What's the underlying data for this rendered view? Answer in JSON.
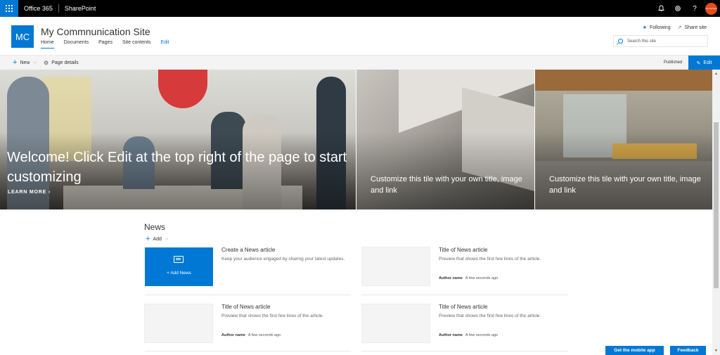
{
  "suitebar": {
    "brand": "Office 365",
    "app": "SharePoint",
    "avatar_text": "Anonymous"
  },
  "site": {
    "logo": "MC",
    "title": "My Commnunication Site",
    "nav": [
      {
        "label": "Home"
      },
      {
        "label": "Documents"
      },
      {
        "label": "Pages"
      },
      {
        "label": "Site contents"
      },
      {
        "label": "Edit"
      }
    ],
    "following": "Following",
    "share": "Share site",
    "search_placeholder": "Search this site"
  },
  "cmdbar": {
    "new": "New",
    "page_details": "Page details",
    "status": "Published",
    "edit": "Edit"
  },
  "hero": {
    "main_title": "Welcome! Click Edit at the top right of the page to start customizing",
    "learn_more": "LEARN MORE",
    "tiles": [
      {
        "text": "Customize this tile with your own title, image and link"
      },
      {
        "text": "Customize this tile with your own title, image and link"
      }
    ]
  },
  "news": {
    "title": "News",
    "add": "Add",
    "add_news": "Add News",
    "create": {
      "title": "Create a News article",
      "body": "Keep your audience engaged by sharing your latest updates."
    },
    "items": [
      {
        "title": "Title of News article",
        "preview": "Preview that shows the first few lines of the article.",
        "author": "Author name",
        "time": "A few seconds ago"
      },
      {
        "title": "Title of News article",
        "preview": "Preview that shows the first few lines of the article.",
        "author": "Author name",
        "time": "A few seconds ago"
      },
      {
        "title": "Title of News article",
        "preview": "Preview that shows the first few lines of the article.",
        "author": "Author name",
        "time": "A few seconds ago"
      }
    ]
  },
  "footer": {
    "mobile_app": "Get the mobile app",
    "feedback": "Feedback"
  },
  "colors": {
    "accent": "#0078d4",
    "suitebar": "#000000",
    "avatar": "#e74c1c"
  }
}
